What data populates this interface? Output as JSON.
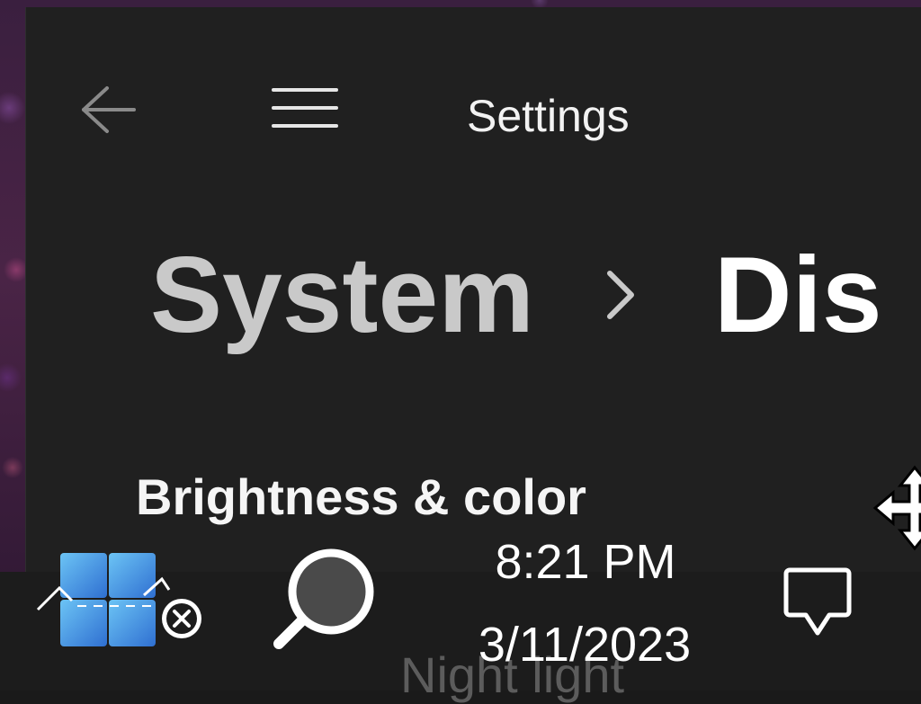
{
  "window": {
    "title": "Settings",
    "back_icon": "back-arrow-icon",
    "menu_icon": "hamburger-menu-icon"
  },
  "breadcrumb": {
    "parent": "System",
    "separator_icon": "chevron-right-icon",
    "current": "Dis"
  },
  "section": {
    "heading": "Brightness & color",
    "next_item": "Night light"
  },
  "taskbar": {
    "start_icon": "windows-logo-icon",
    "start_badge_icon": "close-badge-icon",
    "search_icon": "search-icon",
    "time": "8:21 PM",
    "date": "3/11/2023",
    "notification_icon": "chat-bubble-icon"
  },
  "cursor": {
    "icon": "move-cursor-icon"
  },
  "colors": {
    "window_bg": "#202020",
    "taskbar_bg": "#1c1c1c",
    "accent": "#3b8fe0",
    "text_primary": "#ffffff",
    "text_secondary": "#c9c9c9"
  }
}
